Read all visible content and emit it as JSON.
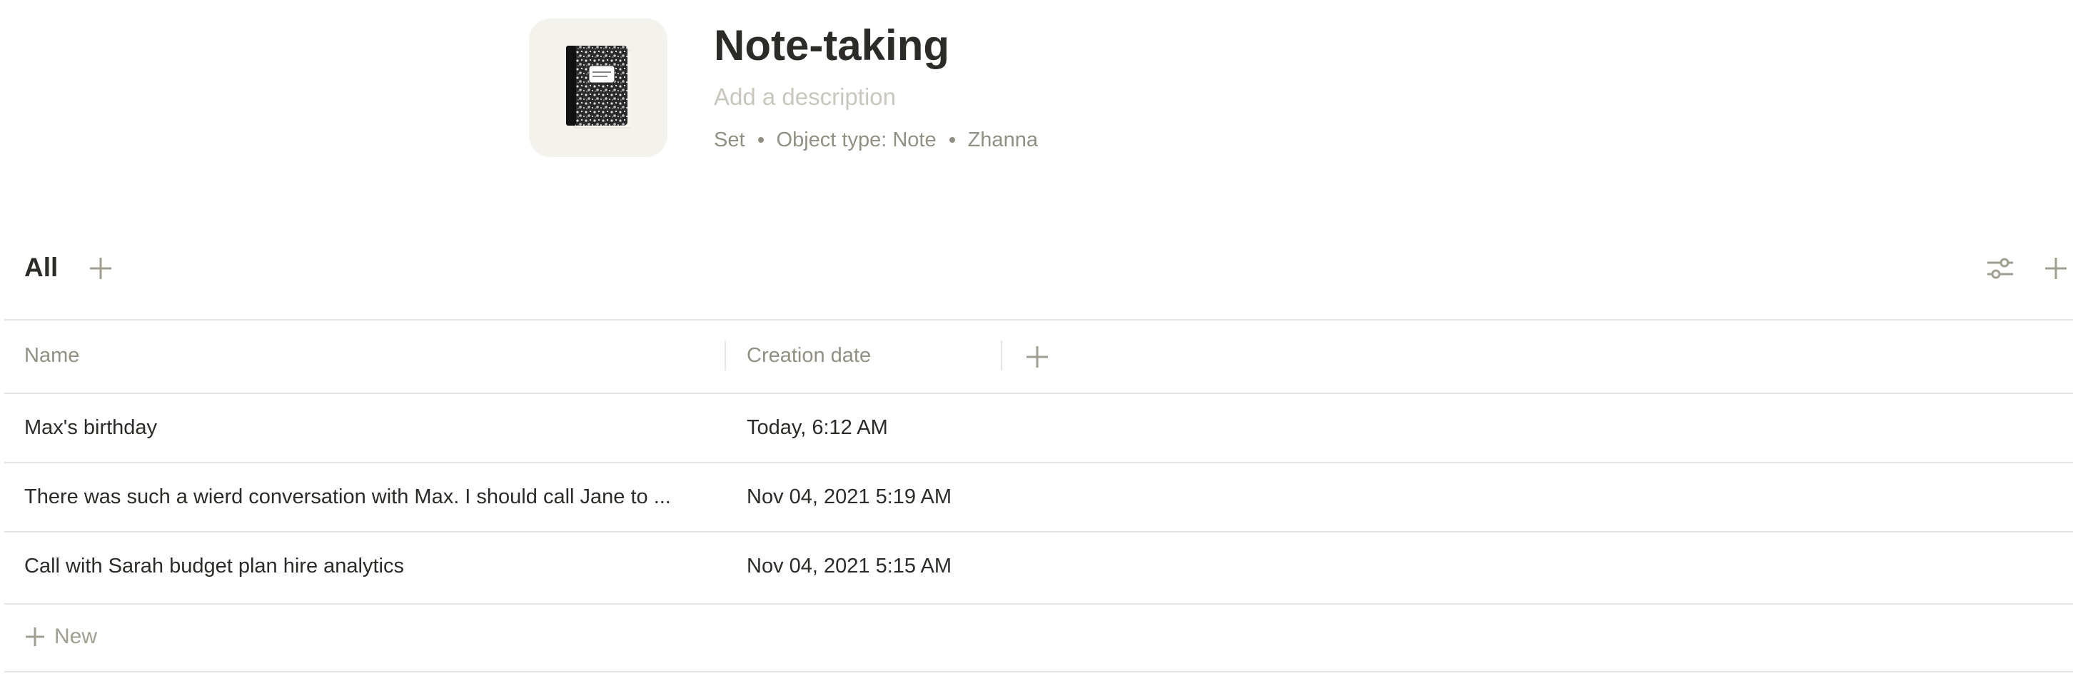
{
  "set": {
    "icon": "composition-notebook-icon",
    "title": "Note-taking",
    "description_placeholder": "Add a description",
    "meta": {
      "kind": "Set",
      "object_type": "Object type: Note",
      "author": "Zhanna"
    }
  },
  "view": {
    "active_tab": "All",
    "add_view_icon": "plus-icon",
    "settings_icon": "sliders-icon",
    "add_record_icon": "plus-icon"
  },
  "table": {
    "columns": [
      "Name",
      "Creation date"
    ],
    "add_column_icon": "plus-icon",
    "rows": [
      {
        "name": "Max's birthday",
        "created": "Today, 6:12 AM"
      },
      {
        "name": "There was such a wierd conversation with Max. I should call Jane to ...",
        "created": "Nov 04, 2021 5:19 AM"
      },
      {
        "name": "Call with Sarah budget plan hire analytics",
        "created": "Nov 04, 2021 5:15 AM"
      }
    ],
    "new_label": "New"
  },
  "colors": {
    "text": "#2c2b27",
    "muted": "#929082",
    "placeholder": "#c9c7bd",
    "divider": "#e6e5df",
    "icon_bg": "#f3f2ec"
  }
}
